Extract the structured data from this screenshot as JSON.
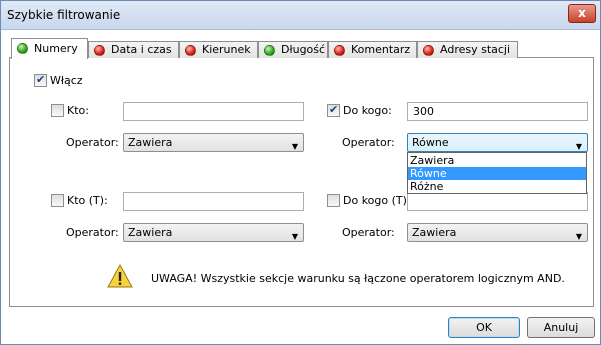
{
  "window": {
    "title": "Szybkie filtrowanie",
    "close_label": "x"
  },
  "tabs": [
    {
      "label": "Numery",
      "status": "green"
    },
    {
      "label": "Data i czas",
      "status": "red"
    },
    {
      "label": "Kierunek",
      "status": "red"
    },
    {
      "label": "Długość",
      "status": "green"
    },
    {
      "label": "Komentarz",
      "status": "red"
    },
    {
      "label": "Adresy stacji",
      "status": "red"
    }
  ],
  "enable": {
    "label": "Włącz",
    "checked": true
  },
  "fields": {
    "kto": {
      "label": "Kto:",
      "checked": false,
      "value": "",
      "operator_label": "Operator:",
      "operator": "Zawiera"
    },
    "do_kogo": {
      "label": "Do kogo:",
      "checked": true,
      "value": "300",
      "operator_label": "Operator:",
      "operator": "Równe"
    },
    "kto_t": {
      "label": "Kto (T):",
      "checked": false,
      "value": "",
      "operator_label": "Operator:",
      "operator": "Zawiera"
    },
    "do_kogo_t": {
      "label": "Do kogo (T):",
      "checked": false,
      "value": "",
      "operator_label": "Operator:",
      "operator": "Zawiera"
    }
  },
  "dropdown_options": [
    "Zawiera",
    "Równe",
    "Różne"
  ],
  "dropdown_selected": "Równe",
  "warning": "UWAGA! Wszystkie sekcje warunku są łączone operatorem logicznym AND.",
  "buttons": {
    "ok": "OK",
    "cancel": "Anuluj"
  },
  "colors": {
    "status_green": "#2fa61c",
    "status_red": "#d82214",
    "selection": "#3399ff"
  }
}
